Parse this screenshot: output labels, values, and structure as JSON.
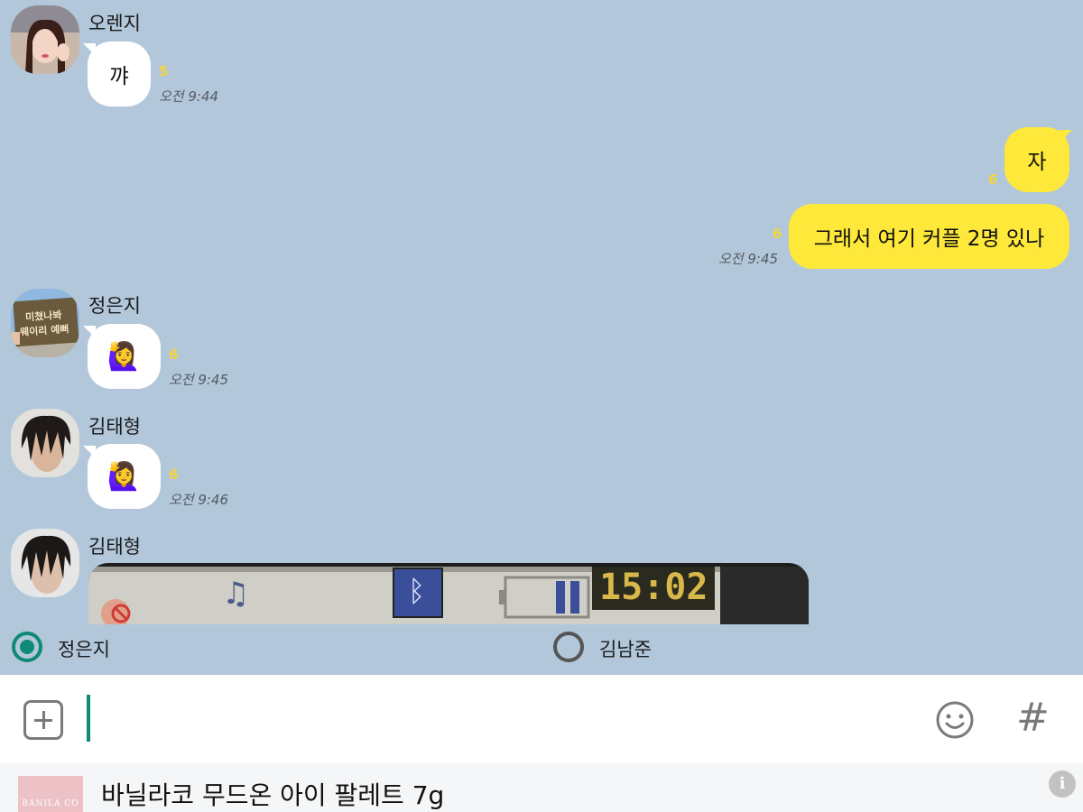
{
  "messages": [
    {
      "sender": "오렌지",
      "avatar": "woman-portrait-avatar",
      "text": "꺄",
      "unread": "5",
      "time": "오전 9:44"
    },
    {
      "direction": "outgoing",
      "text": "자",
      "unread": "6"
    },
    {
      "direction": "outgoing",
      "text": "그래서 여기 커플 2명 있나",
      "unread": "6",
      "time": "오전 9:45"
    },
    {
      "sender": "정은지",
      "avatar_sign_line1": "미쳤나봐",
      "avatar_sign_line2": "웨이리 예뻐",
      "text": "🙋‍♀️",
      "unread": "6",
      "time": "오전 9:45"
    },
    {
      "sender": "김태형",
      "avatar": "man-portrait-avatar",
      "text": "🙋‍♀️",
      "unread": "6",
      "time": "오전 9:46"
    },
    {
      "sender": "김태형",
      "avatar": "man-portrait-avatar",
      "media": {
        "type": "photo",
        "clock_text": "15:02",
        "icons": [
          "music-note-icon",
          "bluetooth-icon",
          "battery-icon"
        ]
      }
    }
  ],
  "poll": {
    "options": [
      {
        "label": "정은지",
        "selected": true
      },
      {
        "label": "김남준",
        "selected": false
      }
    ]
  },
  "composer": {
    "value": "",
    "placeholder": "",
    "icons": [
      "plus-icon",
      "emoji-icon",
      "hashtag-icon"
    ],
    "hash_symbol": "#"
  },
  "ad": {
    "brand": "BANILA CO",
    "title": "바닐라코 무드온 아이 팔레트 7g",
    "info": "i"
  },
  "colors": {
    "background": "#b2c7da",
    "outgoing_bubble": "#fee83a",
    "incoming_bubble": "#ffffff",
    "accent": "#0f8a75",
    "unread": "#f5d43a"
  }
}
